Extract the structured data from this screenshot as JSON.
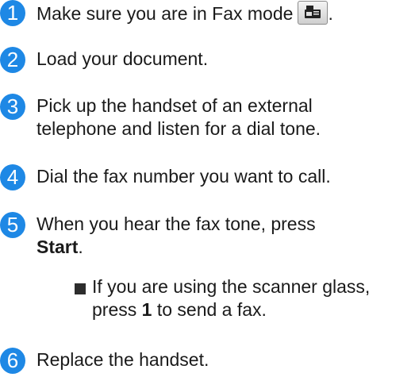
{
  "steps": [
    {
      "number": "1",
      "text": "Make sure you are in Fax mode",
      "suffix": "."
    },
    {
      "number": "2",
      "text": "Load your document."
    },
    {
      "number": "3",
      "line1": "Pick up the handset of an external",
      "line2": "telephone and listen for a dial tone."
    },
    {
      "number": "4",
      "text": "Dial the fax number you want to call."
    },
    {
      "number": "5",
      "line1": "When you hear the fax tone, press",
      "bold": "Start",
      "after_bold": "."
    },
    {
      "number": "6",
      "text": "Replace the handset."
    }
  ],
  "substep": {
    "line1": "If you are using the scanner glass,",
    "pre": "press ",
    "bold": "1",
    "post": " to send a fax."
  },
  "icons": {
    "fax_mode": "fax-machine-icon"
  },
  "colors": {
    "step_badge": "#1e88e5"
  }
}
